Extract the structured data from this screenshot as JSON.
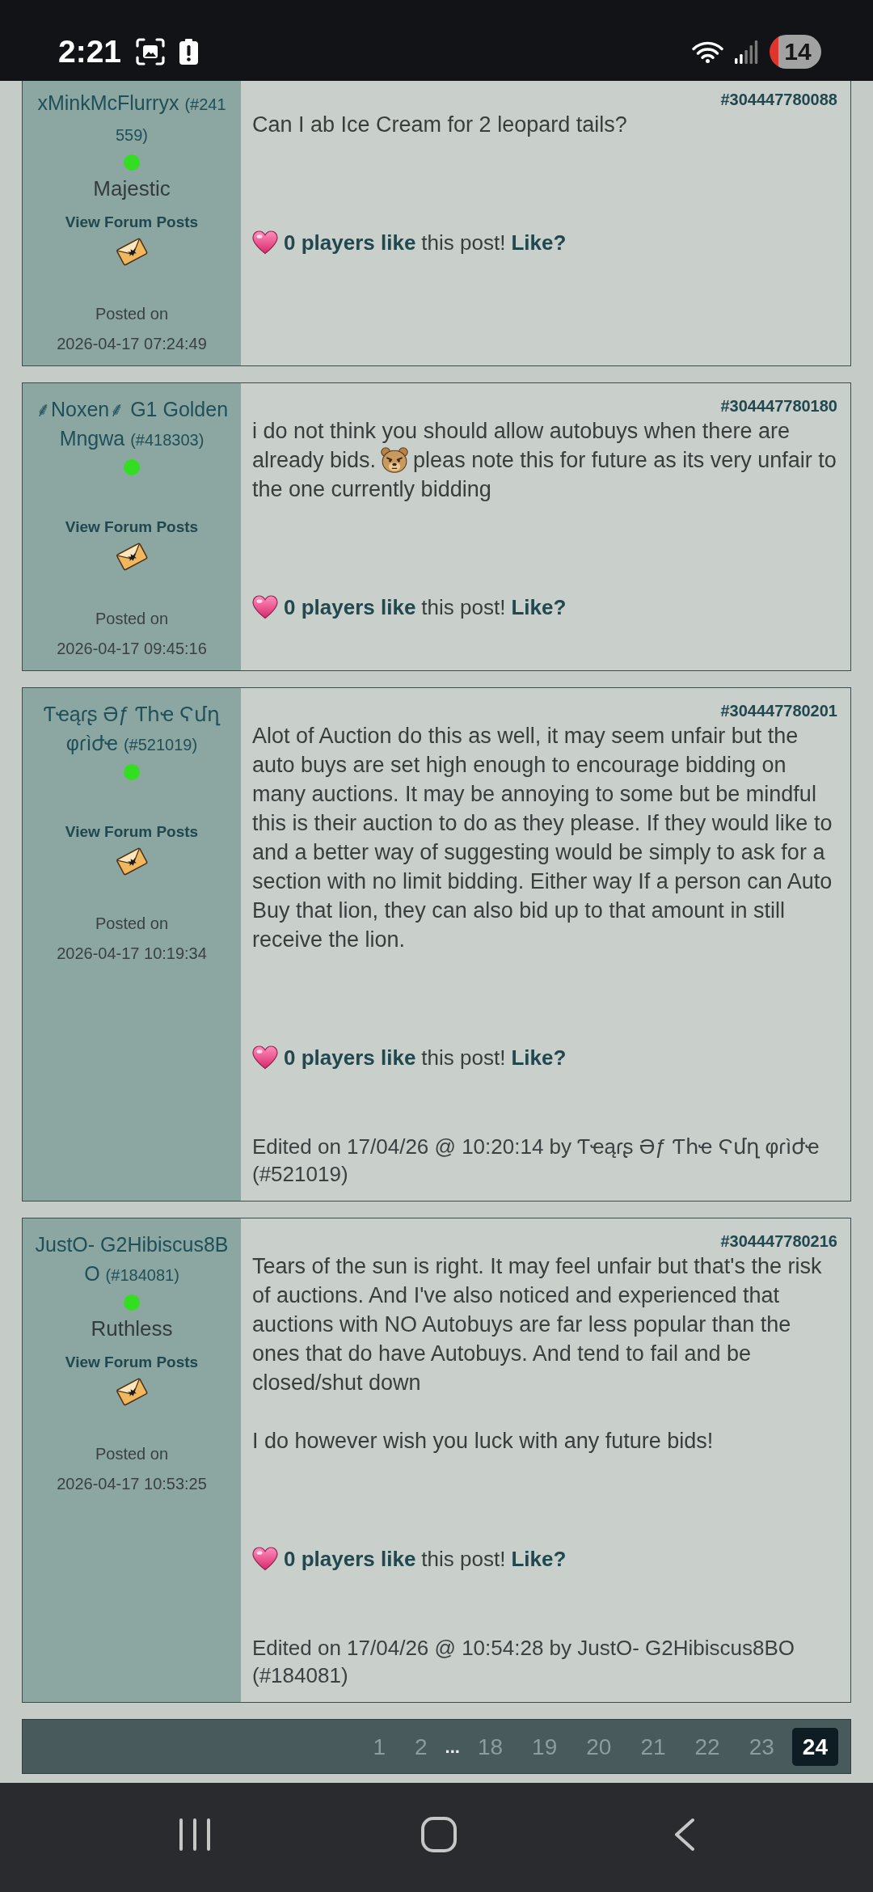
{
  "status_bar": {
    "time": "2:21",
    "battery": "14"
  },
  "posts": [
    {
      "author": "xMinkMcFlurryx",
      "author_id": "(#241559)",
      "online": true,
      "rank": "Majestic",
      "profile_link": "View Forum Posts",
      "posted_label": "Posted on",
      "posted_at": "2026-04-17 07:24:49",
      "post_number": "#304447780088",
      "body": [
        {
          "kind": "paragraph",
          "text": "Can I ab Ice Cream for 2 leopard tails?"
        }
      ],
      "likes": {
        "count": "0 players like",
        "text": "this post!",
        "action": "Like?"
      }
    },
    {
      "author": "⸙Noxen⸙ G1 Golden Mngwa",
      "author_id": "(#418303)",
      "online": true,
      "profile_link": "View Forum Posts",
      "posted_label": "Posted on",
      "posted_at": "2026-04-17 09:45:16",
      "post_number": "#304447780180",
      "body": [
        {
          "kind": "line",
          "parts": [
            {
              "kind": "text",
              "text": "i do not think you should allow autobuys when there are"
            }
          ]
        },
        {
          "kind": "line",
          "parts": [
            {
              "kind": "text",
              "text": "already bids."
            },
            {
              "kind": "emoji"
            },
            {
              "kind": "text",
              "text": "pleas note this for future as its very unfair to"
            }
          ]
        },
        {
          "kind": "line",
          "parts": [
            {
              "kind": "text",
              "text": "the one currently bidding"
            }
          ]
        }
      ],
      "likes": {
        "count": "0 players like",
        "text": "this post!",
        "action": "Like?"
      }
    },
    {
      "author": "Ƭҽąɾʂ Əƒ Ƭհҽ Ϛմղ φɾìժҽ",
      "author_id": "(#521019)",
      "online": true,
      "profile_link": "View Forum Posts",
      "posted_label": "Posted on",
      "posted_at": "2026-04-17 10:19:34",
      "post_number": "#304447780201",
      "body": [
        {
          "kind": "paragraph",
          "text": "Alot of Auction do this as well, it may seem unfair but the auto buys are set high enough to encourage bidding on many auctions. It may be annoying to some but be mindful this is their auction to do as they please. If they would like to and a better way of suggesting would be simply to ask for a section with no limit bidding. Either way If a person can Auto Buy that lion, they can also bid up to that amount in still receive the lion."
        }
      ],
      "likes": {
        "count": "0 players like",
        "text": "this post!",
        "action": "Like?"
      },
      "edited": "Edited on 17/04/26 @ 10:20:14 by Ƭҽąɾʂ Əƒ Ƭհҽ Ϛմղ φɾìժҽ (#521019)"
    },
    {
      "author": "JustO- G2Hibiscus8BO",
      "author_id": "(#184081)",
      "online": true,
      "rank": "Ruthless",
      "profile_link": "View Forum Posts",
      "posted_label": "Posted on",
      "posted_at": "2026-04-17 10:53:25",
      "post_number": "#304447780216",
      "body": [
        {
          "kind": "paragraph",
          "text": "Tears of the sun is right. It may feel unfair but that's the risk of auctions. And I've also noticed and experienced that auctions with NO Autobuys are far less popular than the ones that do have Autobuys. And tend to fail and be closed/shut down"
        },
        {
          "kind": "paragraph",
          "text": "I do however wish you luck with any future bids!"
        }
      ],
      "likes": {
        "count": "0 players like",
        "text": "this post!",
        "action": "Like?"
      },
      "edited": "Edited on 17/04/26 @ 10:54:28 by JustO- G2Hibiscus8BO (#184081)"
    }
  ],
  "pagination": {
    "pages": [
      {
        "kind": "page",
        "label": "1",
        "selected": false
      },
      {
        "kind": "page",
        "label": "2",
        "selected": false
      },
      {
        "kind": "ellipsis",
        "label": "...",
        "selected": false
      },
      {
        "kind": "page",
        "label": "18",
        "selected": false
      },
      {
        "kind": "page",
        "label": "19",
        "selected": false
      },
      {
        "kind": "page",
        "label": "20",
        "selected": false
      },
      {
        "kind": "page",
        "label": "21",
        "selected": false
      },
      {
        "kind": "page",
        "label": "22",
        "selected": false
      },
      {
        "kind": "page",
        "label": "23",
        "selected": false
      },
      {
        "kind": "page",
        "label": "24",
        "selected": true
      }
    ]
  }
}
